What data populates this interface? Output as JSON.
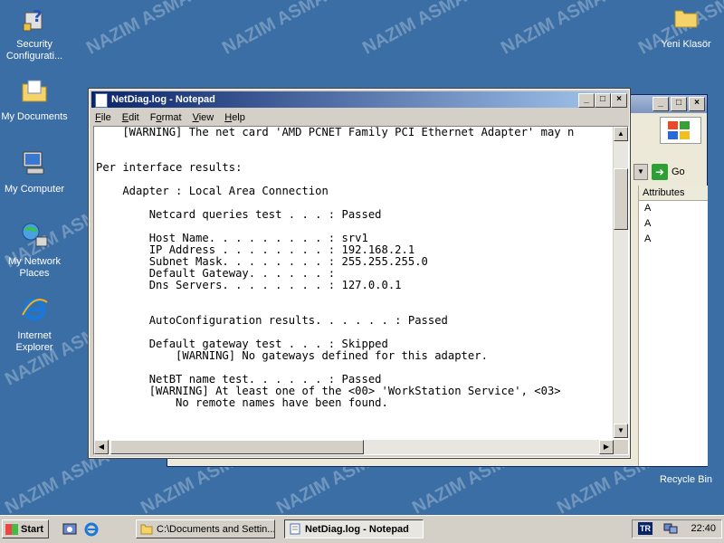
{
  "desktop": {
    "watermark": "NAZIM ASMA",
    "icons": [
      {
        "id": "security",
        "label": "Security Configurati..."
      },
      {
        "id": "mydocs",
        "label": "My Documents"
      },
      {
        "id": "mycomputer",
        "label": "My Computer"
      },
      {
        "id": "network",
        "label": "My Network Places"
      },
      {
        "id": "ie",
        "label": "Internet Explorer"
      },
      {
        "id": "folder",
        "label": "Yeni Klasör"
      },
      {
        "id": "recycle",
        "label": "Recycle Bin"
      }
    ]
  },
  "explorer": {
    "go_label": "Go",
    "column_header": "Attributes",
    "attr_values": [
      "A",
      "A",
      "A"
    ]
  },
  "notepad": {
    "title": "NetDiag.log - Notepad",
    "menu": [
      "File",
      "Edit",
      "Format",
      "View",
      "Help"
    ],
    "menu_mnemonics": [
      "F",
      "E",
      "o",
      "V",
      "H"
    ],
    "lines": [
      "    [WARNING] The net card 'AMD PCNET Family PCI Ethernet Adapter' may n",
      "",
      "",
      "Per interface results:",
      "",
      "    Adapter : Local Area Connection",
      "",
      "        Netcard queries test . . . : Passed",
      "",
      "        Host Name. . . . . . . . . : srv1",
      "        IP Address . . . . . . . . : 192.168.2.1",
      "        Subnet Mask. . . . . . . . : 255.255.255.0",
      "        Default Gateway. . . . . . :",
      "        Dns Servers. . . . . . . . : 127.0.0.1",
      "",
      "",
      "        AutoConfiguration results. . . . . . : Passed",
      "",
      "        Default gateway test . . . : Skipped",
      "            [WARNING] No gateways defined for this adapter.",
      "",
      "        NetBT name test. . . . . . : Passed",
      "        [WARNING] At least one of the <00> 'WorkStation Service', <03>",
      "            No remote names have been found."
    ]
  },
  "taskbar": {
    "start_label": "Start",
    "tasks": [
      {
        "label": "C:\\Documents and Settin...",
        "active": false
      },
      {
        "label": "NetDiag.log - Notepad",
        "active": true
      }
    ],
    "language": "TR",
    "clock": "22:40"
  }
}
